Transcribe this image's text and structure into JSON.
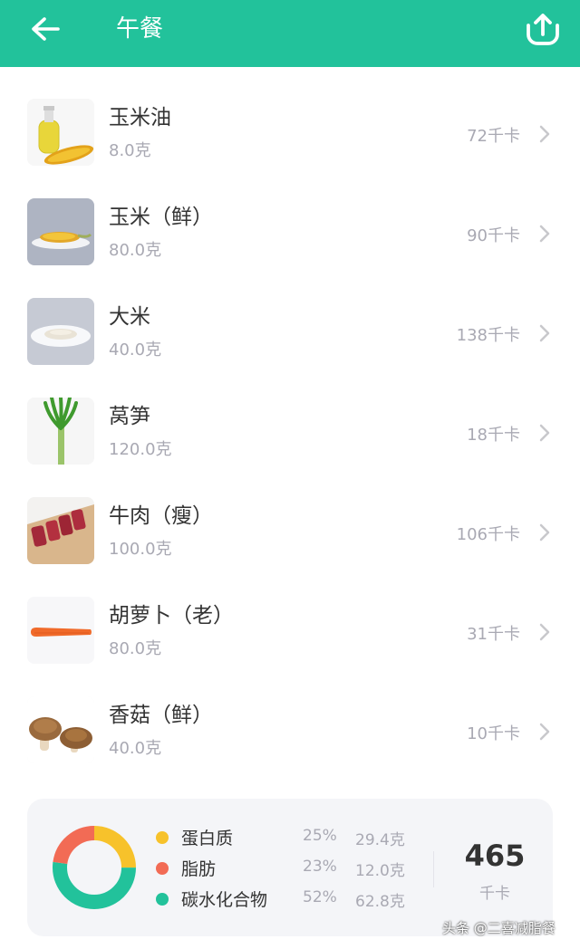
{
  "header": {
    "title": "午餐",
    "bg_color": "#22c29b",
    "back_icon": "arrow-left-icon",
    "share_icon": "share-upload-icon"
  },
  "foods": [
    {
      "name": "玉米油",
      "amount": "8.0克",
      "kcal": "72千卡",
      "icon": "corn-oil-icon"
    },
    {
      "name": "玉米（鲜）",
      "amount": "80.0克",
      "kcal": "90千卡",
      "icon": "corn-icon"
    },
    {
      "name": "大米",
      "amount": "40.0克",
      "kcal": "138千卡",
      "icon": "rice-icon"
    },
    {
      "name": "莴笋",
      "amount": "120.0克",
      "kcal": "18千卡",
      "icon": "lettuce-stem-icon"
    },
    {
      "name": "牛肉（瘦）",
      "amount": "100.0克",
      "kcal": "106千卡",
      "icon": "beef-icon"
    },
    {
      "name": "胡萝卜（老）",
      "amount": "80.0克",
      "kcal": "31千卡",
      "icon": "carrot-icon"
    },
    {
      "name": "香菇（鲜）",
      "amount": "40.0克",
      "kcal": "10千卡",
      "icon": "mushroom-icon"
    }
  ],
  "summary": {
    "macros": [
      {
        "name": "蛋白质",
        "pct": "25%",
        "grams": "29.4克",
        "fraction": 0.25,
        "color": "#f7c22b"
      },
      {
        "name": "脂肪",
        "pct": "23%",
        "grams": "12.0克",
        "fraction": 0.23,
        "color": "#f26b55"
      },
      {
        "name": "碳水化合物",
        "pct": "52%",
        "grams": "62.8克",
        "fraction": 0.52,
        "color": "#22c29b"
      }
    ],
    "total": "465",
    "total_unit": "千卡"
  },
  "watermark": "头条 @二喜减脂餐"
}
